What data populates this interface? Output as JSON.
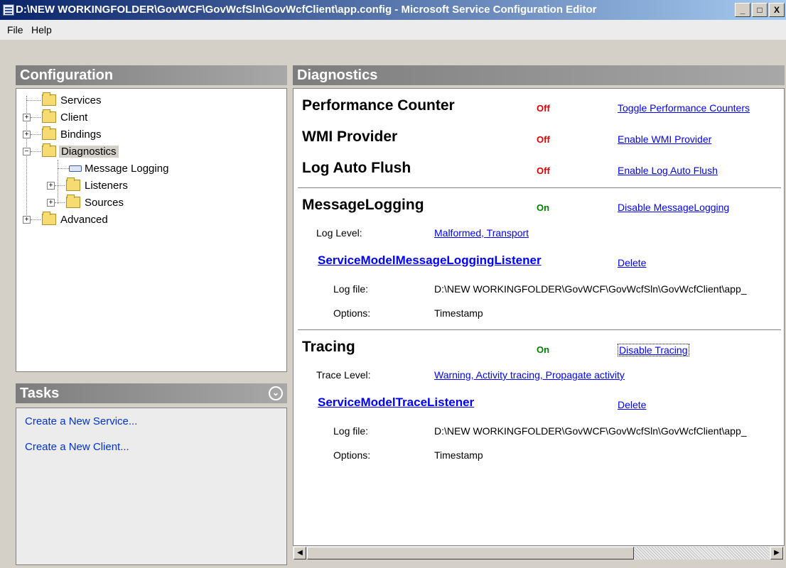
{
  "window": {
    "title": "D:\\NEW WORKINGFOLDER\\GovWCF\\GovWcfSln\\GovWcfClient\\app.config - Microsoft Service Configuration Editor",
    "minimize": "_",
    "maximize": "□",
    "close": "X"
  },
  "menu": {
    "file": "File",
    "help": "Help"
  },
  "config_panel": {
    "title": "Configuration",
    "tree": {
      "services": "Services",
      "client": "Client",
      "bindings": "Bindings",
      "diagnostics": "Diagnostics",
      "message_logging": "Message Logging",
      "listeners": "Listeners",
      "sources": "Sources",
      "advanced": "Advanced"
    }
  },
  "tasks_panel": {
    "title": "Tasks",
    "items": [
      "Create a New Service...",
      "Create a New Client..."
    ]
  },
  "diagnostics": {
    "title": "Diagnostics",
    "perf_counter": {
      "label": "Performance Counter",
      "state": "Off",
      "link": "Toggle Performance Counters"
    },
    "wmi": {
      "label": "WMI Provider",
      "state": "Off",
      "link": "Enable WMI Provider"
    },
    "auto_flush": {
      "label": "Log Auto Flush",
      "state": "Off",
      "link": "Enable Log Auto Flush"
    },
    "message_logging": {
      "label": "MessageLogging",
      "state": "On",
      "link": "Disable MessageLogging",
      "log_level_label": "Log Level:",
      "log_level_value": "Malformed, Transport",
      "listener_name": "ServiceModelMessageLoggingListener",
      "delete": "Delete",
      "log_file_label": "Log file:",
      "log_file_value": "D:\\NEW WORKINGFOLDER\\GovWCF\\GovWcfSln\\GovWcfClient\\app_",
      "options_label": "Options:",
      "options_value": "Timestamp"
    },
    "tracing": {
      "label": "Tracing",
      "state": "On",
      "link": "Disable Tracing",
      "trace_level_label": "Trace Level:",
      "trace_level_value": "Warning, Activity tracing, Propagate activity",
      "listener_name": "ServiceModelTraceListener",
      "delete": "Delete",
      "log_file_label": "Log file:",
      "log_file_value": "D:\\NEW WORKINGFOLDER\\GovWCF\\GovWcfSln\\GovWcfClient\\app_",
      "options_label": "Options:",
      "options_value": "Timestamp"
    }
  },
  "colors": {
    "off": "#e00000",
    "on": "#008000",
    "link": "#0000ff",
    "titlebar": "#0a246a"
  }
}
